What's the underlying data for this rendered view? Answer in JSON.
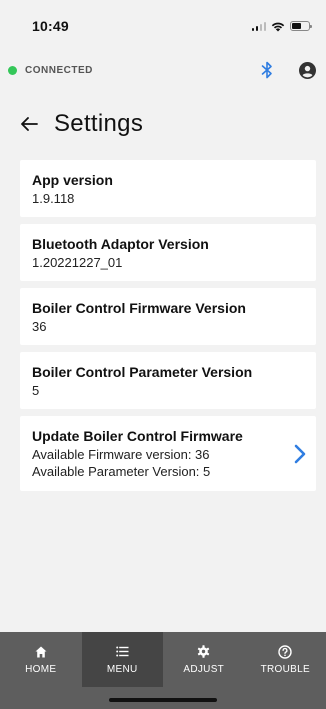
{
  "status_bar": {
    "time": "10:49"
  },
  "connection": {
    "status_label": "CONNECTED",
    "dot_color": "#34c759",
    "bluetooth_color": "#2f7de1"
  },
  "header": {
    "title": "Settings"
  },
  "settings": [
    {
      "title": "App version",
      "value": "1.9.118"
    },
    {
      "title": "Bluetooth Adaptor Version",
      "value": "1.20221227_01"
    },
    {
      "title": "Boiler Control Firmware Version",
      "value": "36"
    },
    {
      "title": "Boiler Control Parameter Version",
      "value": "5"
    }
  ],
  "update": {
    "title": "Update Boiler Control Firmware",
    "line1": "Available Firmware version: 36",
    "line2": "Available Parameter Version: 5",
    "chevron_color": "#2f7de1"
  },
  "nav": {
    "items": [
      {
        "label": "HOME",
        "icon": "home-icon"
      },
      {
        "label": "MENU",
        "icon": "menu-icon"
      },
      {
        "label": "ADJUST",
        "icon": "gear-icon"
      },
      {
        "label": "TROUBLE",
        "icon": "help-icon"
      }
    ],
    "active": "MENU"
  }
}
